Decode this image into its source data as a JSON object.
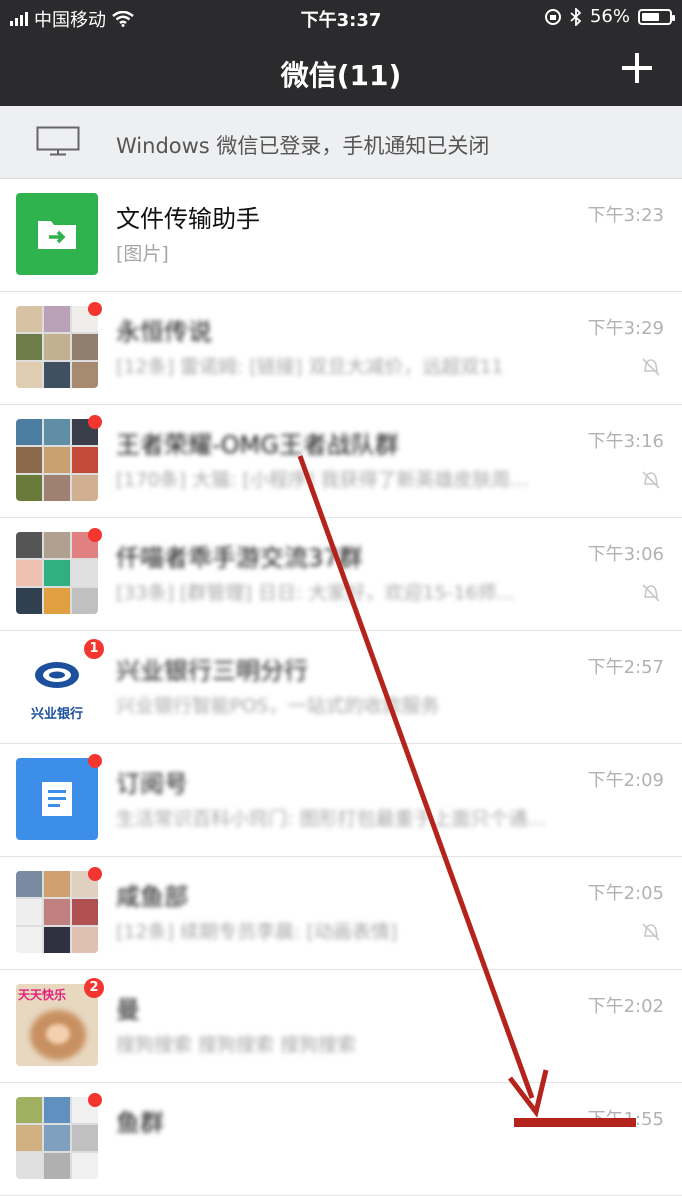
{
  "status_bar": {
    "carrier": "中国移动",
    "time": "下午3:37",
    "battery": "56%",
    "battery_level": 0.56
  },
  "nav": {
    "title": "微信(11)",
    "add_icon": "plus-icon"
  },
  "notice": {
    "icon": "desktop-monitor-icon",
    "text": "Windows 微信已登录，手机通知已关闭"
  },
  "chats": [
    {
      "name": "文件传输助手",
      "preview": "[图片]",
      "time": "下午3:23",
      "muted": false,
      "badge": "",
      "blurred": false,
      "avatar": "file-transfer-icon",
      "color": "#2fb34f"
    },
    {
      "name": "永恒传说",
      "preview": "[12条] 雷诺姆: [链接] 双旦大减价，远超双11",
      "time": "下午3:29",
      "muted": true,
      "badge": "dot",
      "blurred": true,
      "avatar": "group-avatar"
    },
    {
      "name": "王者荣耀-OMG王者战队群",
      "preview": "[170条] 大猫: [小程序] 我获得了新英雄皮肤周...",
      "time": "下午3:16",
      "muted": true,
      "badge": "dot",
      "blurred": true,
      "avatar": "group-avatar"
    },
    {
      "name": "仟喵者乖手游交流37群",
      "preview": "[33条] [群管理] 日日: 大家好，欢迎15-16师...",
      "time": "下午3:06",
      "muted": true,
      "badge": "dot",
      "blurred": true,
      "avatar": "group-avatar"
    },
    {
      "name": "兴业银行三明分行",
      "preview": "兴业银行智能POS，一站式的收款服务",
      "time": "下午2:57",
      "muted": false,
      "badge": "1",
      "blurred": true,
      "avatar": "bank-logo",
      "logo_text": "兴业银行"
    },
    {
      "name": "订阅号",
      "preview": "生活常识百科小窍门: 图形打包最重于上面只个通...",
      "time": "下午2:09",
      "muted": false,
      "badge": "dot",
      "blurred": true,
      "avatar": "subscription-icon",
      "color": "#3d8ee8"
    },
    {
      "name": "咸鱼部",
      "preview": "[12条] 续期专员李晨: [动画表情]",
      "time": "下午2:05",
      "muted": true,
      "badge": "dot",
      "blurred": true,
      "avatar": "group-avatar"
    },
    {
      "name": "曼",
      "preview": "搜狗搜索 搜狗搜索 搜狗搜索",
      "time": "下午2:02",
      "muted": false,
      "badge": "2",
      "blurred": true,
      "avatar": "person-avatar",
      "caption": "天天快乐"
    },
    {
      "name": "鱼群",
      "preview": "",
      "time": "下午1:55",
      "muted": false,
      "badge": "dot",
      "blurred": true,
      "avatar": "group-avatar"
    }
  ],
  "annotation": {
    "color": "#b5241c"
  }
}
